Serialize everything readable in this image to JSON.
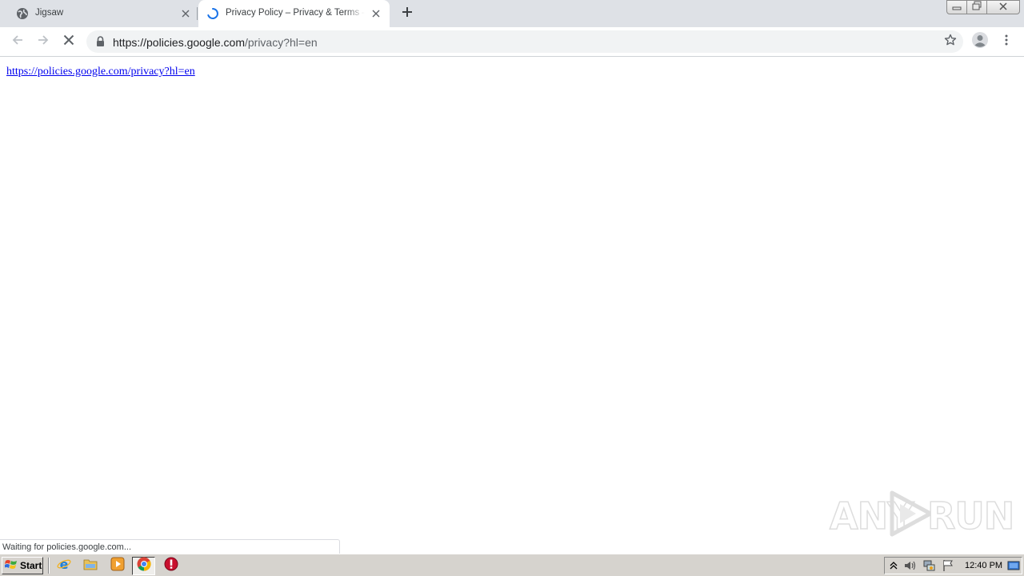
{
  "browser": {
    "tabs": [
      {
        "title": "Jigsaw",
        "active": false,
        "favicon": "globe-icon"
      },
      {
        "title": "Privacy Policy – Privacy & Terms – Google",
        "active": true,
        "favicon": "loading-spinner-icon"
      }
    ],
    "new_tab_icon": "plus-icon",
    "window_controls": [
      "minimize-icon",
      "restore-icon",
      "close-icon"
    ]
  },
  "toolbar": {
    "url_host": "https://policies.google.com",
    "url_path": "/privacy?hl=en",
    "icons": [
      "back-arrow-icon",
      "forward-arrow-icon",
      "stop-icon",
      "lock-icon",
      "star-icon",
      "profile-icon",
      "kebab-menu-icon"
    ]
  },
  "page": {
    "link_text": "https://policies.google.com/privacy?hl=en"
  },
  "status_bar": {
    "text": "Waiting for policies.google.com..."
  },
  "watermark": {
    "left": "ANY",
    "right": "RUN"
  },
  "taskbar": {
    "start_label": "Start",
    "quick_launch": [
      "internet-explorer-icon",
      "file-explorer-icon",
      "media-player-icon",
      "chrome-icon",
      "stop-sign-icon"
    ],
    "tray_icons": [
      "show-hidden-icons-arrow",
      "volume-icon",
      "network-icon",
      "action-center-flag-icon",
      "show-desktop-icon"
    ],
    "clock": "12:40 PM"
  },
  "colors": {
    "tab_strip": "#dee1e6",
    "omnibox": "#f1f3f4",
    "link": "#0000ee",
    "taskbar": "#d6d3ce",
    "chrome_blue": "#1a73e8"
  }
}
